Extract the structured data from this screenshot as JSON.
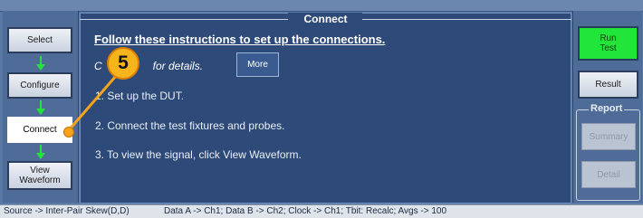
{
  "window": {
    "title": "Connect"
  },
  "steps": [
    {
      "label": "Select"
    },
    {
      "label": "Configure"
    },
    {
      "label": "Connect",
      "active": true
    },
    {
      "label": "View Waveform",
      "line1": "View",
      "line2": "Waveform"
    }
  ],
  "main": {
    "heading": "Follow these instructions to set up the connections.",
    "details_prefix": "C",
    "details_suffix": "for details.",
    "more_label": "More",
    "instructions": [
      "1. Set up the DUT.",
      "2. Connect the test fixtures and probes.",
      "3. To view the signal, click View Waveform."
    ]
  },
  "right_panel": {
    "run_test_line1": "Run",
    "run_test_line2": "Test",
    "result_label": "Result",
    "report_group_label": "Report",
    "summary_label": "Summary",
    "detail_label": "Detail"
  },
  "callout": {
    "number": "5"
  },
  "status_bar": {
    "source": "Source -> Inter-Pair Skew(D,D)",
    "config": "Data A -> Ch1; Data B -> Ch2; Clock -> Ch1; Tbit: Recalc; Avgs -> 100"
  },
  "colors": {
    "panel_bg": "#2e4a78",
    "run_test": "#22e53a",
    "callout": "#f5b31c"
  }
}
